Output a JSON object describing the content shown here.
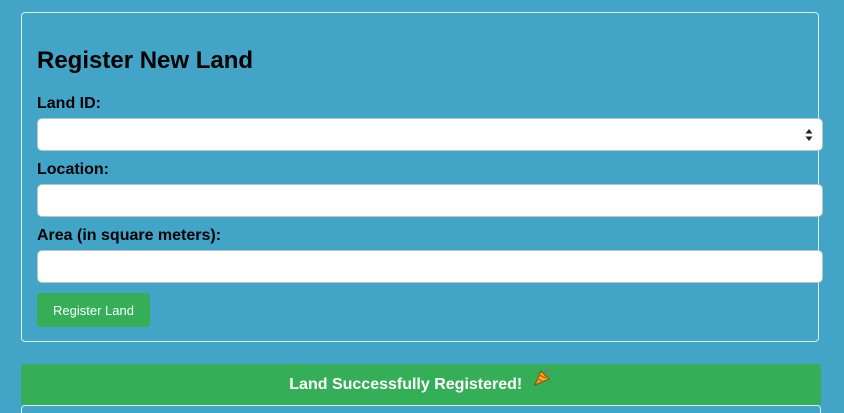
{
  "form": {
    "title": "Register New Land",
    "land_id_label": "Land ID:",
    "land_id_value": "",
    "location_label": "Location:",
    "location_value": "",
    "area_label": "Area (in square meters):",
    "area_value": "",
    "submit_label": "Register Land"
  },
  "status": {
    "message": "Land Successfully Registered!",
    "icon": "party-popper-icon"
  },
  "colors": {
    "background": "#42a5c8",
    "accent_green": "#35ae58",
    "text": "#000000"
  }
}
